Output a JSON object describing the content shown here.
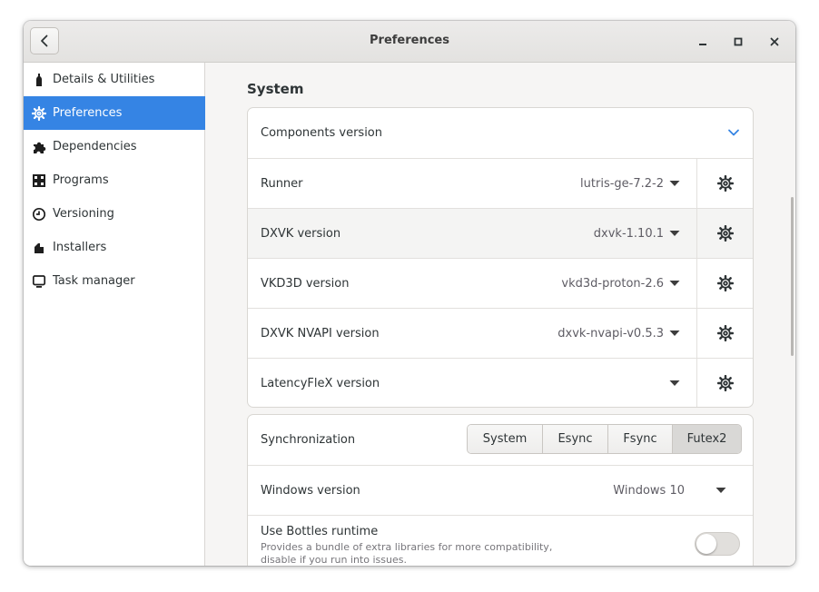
{
  "window": {
    "title": "Preferences"
  },
  "sidebar": {
    "items": [
      {
        "label": "Details & Utilities",
        "icon": "bottle-icon"
      },
      {
        "label": "Preferences",
        "icon": "gear-icon",
        "active": true
      },
      {
        "label": "Dependencies",
        "icon": "puzzle-icon"
      },
      {
        "label": "Programs",
        "icon": "grid-icon"
      },
      {
        "label": "Versioning",
        "icon": "clock-icon"
      },
      {
        "label": "Installers",
        "icon": "package-icon"
      },
      {
        "label": "Task manager",
        "icon": "monitor-icon"
      }
    ]
  },
  "main": {
    "section_title": "System",
    "components": {
      "header": "Components version",
      "rows": [
        {
          "label": "Runner",
          "value": "lutris-ge-7.2-2"
        },
        {
          "label": "DXVK version",
          "value": "dxvk-1.10.1"
        },
        {
          "label": "VKD3D version",
          "value": "vkd3d-proton-2.6"
        },
        {
          "label": "DXVK NVAPI version",
          "value": "dxvk-nvapi-v0.5.3"
        },
        {
          "label": "LatencyFleX version",
          "value": ""
        }
      ]
    },
    "sync": {
      "label": "Synchronization",
      "options": [
        "System",
        "Esync",
        "Fsync",
        "Futex2"
      ],
      "selected": "Futex2"
    },
    "windows_version": {
      "label": "Windows version",
      "value": "Windows 10"
    },
    "bottles_runtime": {
      "label": "Use Bottles runtime",
      "description_line1": "Provides a bundle of extra libraries for more compatibility,",
      "description_line2": "disable if you run into issues.",
      "enabled": false
    }
  },
  "colors": {
    "accent": "#3584e4",
    "chevron": "#3584e4"
  }
}
